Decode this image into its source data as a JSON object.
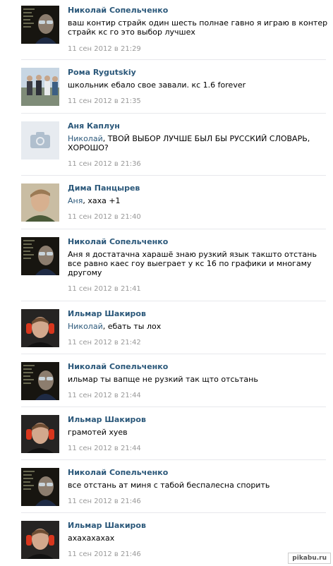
{
  "comments": [
    {
      "author": "Николай Сопельченко",
      "avatar": "avatar-nikolay",
      "text_reply": "",
      "text": "ваш контир страйк один шесть полнае гавно я играю в контер страйк кс го это выбор лучшех",
      "date": "11 сен 2012 в 21:29"
    },
    {
      "author": "Рома Rygutskiy",
      "avatar": "avatar-roma",
      "text_reply": "",
      "text": "школьник ебало свое завали. кс 1.6 forever",
      "date": "11 сен 2012 в 21:35"
    },
    {
      "author": "Аня Каплун",
      "avatar": "camera-icon",
      "text_reply": "Николай",
      "text": ", ТВОЙ ВЫБОР ЛУЧШЕ БЫЛ БЫ РУССКИЙ СЛОВАРЬ, ХОРОШО?",
      "date": "11 сен 2012 в 21:36"
    },
    {
      "author": "Дима Панцырев",
      "avatar": "avatar-dima",
      "text_reply": "Аня",
      "text": ", хаха +1",
      "date": "11 сен 2012 в 21:40"
    },
    {
      "author": "Николай Сопельченко",
      "avatar": "avatar-nikolay",
      "text_reply": "",
      "text": "Аня я достатачна харашё знаю рузкий язык такшто отстань все равно каес гоу выеграет у кс 16 по графики и многаму другому",
      "date": "11 сен 2012 в 21:41"
    },
    {
      "author": "Ильмар Шакиров",
      "avatar": "avatar-ilmar",
      "text_reply": "Николай",
      "text": ", ебать ты лох",
      "date": "11 сен 2012 в 21:42"
    },
    {
      "author": "Николай Сопельченко",
      "avatar": "avatar-nikolay",
      "text_reply": "",
      "text": "ильмар ты вапще не рузкий так щто отсьтань",
      "date": "11 сен 2012 в 21:44"
    },
    {
      "author": "Ильмар Шакиров",
      "avatar": "avatar-ilmar",
      "text_reply": "",
      "text": "грамотей хуев",
      "date": "11 сен 2012 в 21:44"
    },
    {
      "author": "Николай Сопельченко",
      "avatar": "avatar-nikolay",
      "text_reply": "",
      "text": "все отстань ат миня с табой беспалесна спорить",
      "date": "11 сен 2012 в 21:46"
    },
    {
      "author": "Ильмар Шакиров",
      "avatar": "avatar-ilmar",
      "text_reply": "",
      "text": "ахахахахах",
      "date": "11 сен 2012 в 21:46"
    }
  ],
  "watermark": "pikabu.ru",
  "colors": {
    "name_link": "#2b587a",
    "date": "#999999",
    "separator": "#e7e8ec"
  }
}
